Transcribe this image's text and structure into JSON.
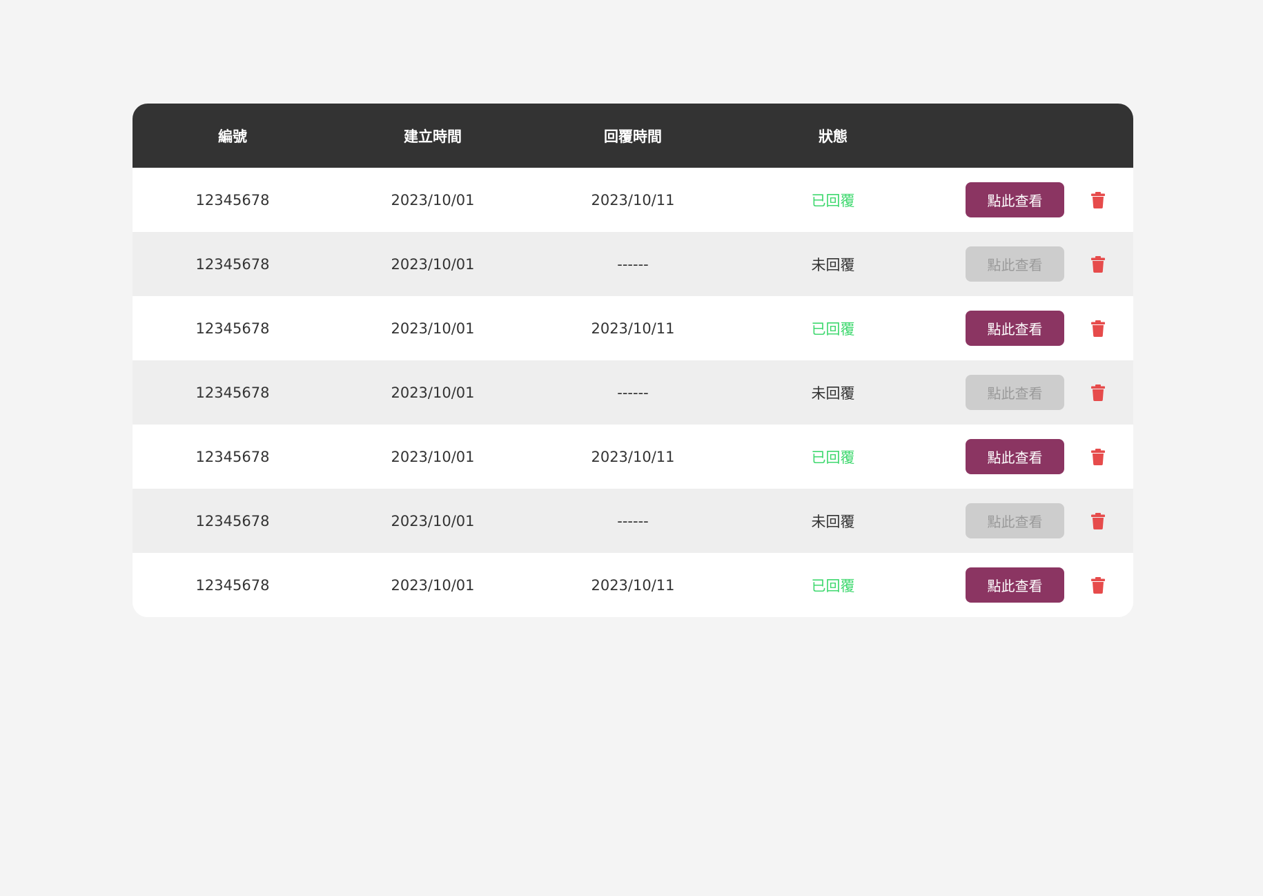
{
  "table": {
    "headers": [
      "編號",
      "建立時間",
      "回覆時間",
      "狀態",
      ""
    ],
    "rows": [
      {
        "id": "12345678",
        "created": "2023/10/01",
        "replied": "2023/10/11",
        "status": "已回覆",
        "action": "點此查看"
      },
      {
        "id": "12345678",
        "created": "2023/10/01",
        "replied": "------",
        "status": "未回覆",
        "action": "點此查看"
      },
      {
        "id": "12345678",
        "created": "2023/10/01",
        "replied": "2023/10/11",
        "status": "已回覆",
        "action": "點此查看"
      },
      {
        "id": "12345678",
        "created": "2023/10/01",
        "replied": "------",
        "status": "未回覆",
        "action": "點此查看"
      },
      {
        "id": "12345678",
        "created": "2023/10/01",
        "replied": "2023/10/11",
        "status": "已回覆",
        "action": "點此查看"
      },
      {
        "id": "12345678",
        "created": "2023/10/01",
        "replied": "------",
        "status": "未回覆",
        "action": "點此查看"
      },
      {
        "id": "12345678",
        "created": "2023/10/01",
        "replied": "2023/10/11",
        "status": "已回覆",
        "action": "點此查看"
      }
    ]
  },
  "icons": {
    "delete": "trash-icon"
  },
  "colors": {
    "header_bg": "#333333",
    "replied_status": "#3ed86e",
    "view_button_active": "#8b3562",
    "view_button_disabled": "#cdcdcd",
    "delete_icon": "#e64b4b"
  }
}
